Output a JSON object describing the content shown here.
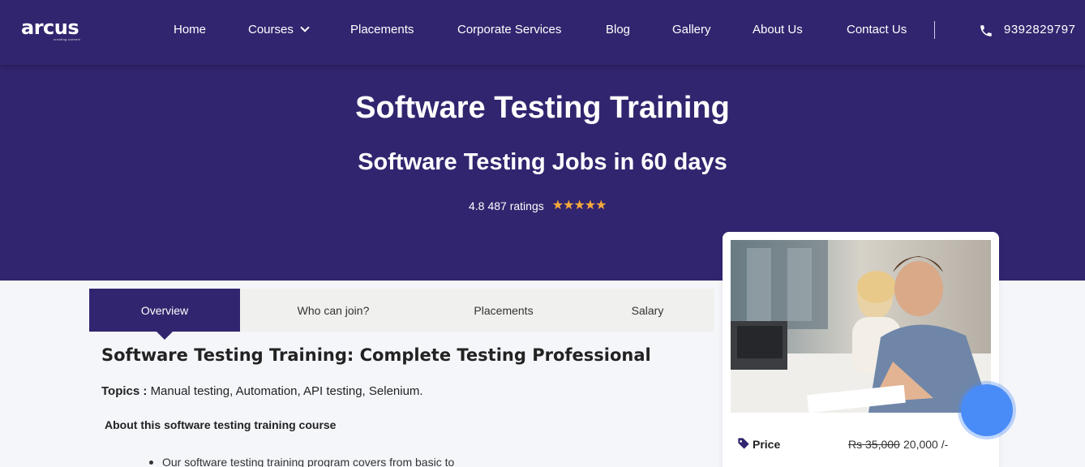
{
  "nav": {
    "logo_text": "arcus",
    "logo_subtext": "creating careers",
    "items": [
      {
        "label": "Home"
      },
      {
        "label": "Courses"
      },
      {
        "label": "Placements"
      },
      {
        "label": "Corporate Services"
      },
      {
        "label": "Blog"
      },
      {
        "label": "Gallery"
      },
      {
        "label": "About Us"
      },
      {
        "label": "Contact Us"
      }
    ],
    "phone": "9392829797",
    "phone_icon": "phone-icon"
  },
  "hero": {
    "title": "Software Testing Training",
    "subtitle": "Software Testing Jobs in 60 days",
    "rating_value": "4.8",
    "rating_count": "487 ratings",
    "stars": 5,
    "star_color": "#f6a93b"
  },
  "tabs": [
    {
      "label": "Overview",
      "active": true
    },
    {
      "label": "Who can join?"
    },
    {
      "label": "Placements"
    },
    {
      "label": "Salary"
    }
  ],
  "content": {
    "title": "Software Testing Training: Complete Testing Professional",
    "topics_label": "Topics :",
    "topics_value": "Manual testing, Automation, API testing, Selenium.",
    "about_heading": "About this software testing training course",
    "bullet_1": "Our software testing training program covers from basic to"
  },
  "card": {
    "price_label": "Price",
    "price_old": "Rs 35,000",
    "price_new": "20,000 /-",
    "tag_icon": "tag-icon"
  },
  "colors": {
    "brand": "#32256f",
    "accent_blue": "#4a8cf7"
  }
}
